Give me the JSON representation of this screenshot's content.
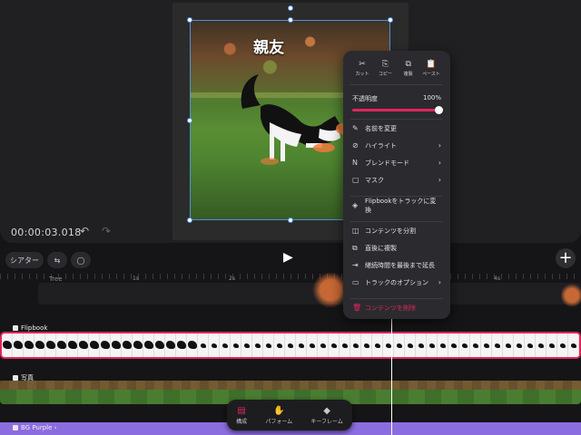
{
  "canvas": {
    "title_text": "親友",
    "timecode": "00:00:03.018"
  },
  "controls": {
    "theater_label": "シアター"
  },
  "timeline": {
    "ruler_labels": [
      "1s",
      "2s",
      "3s",
      "4s"
    ],
    "tree_track_label": "Tree",
    "flipbook_track_label": "Flipbook",
    "bg_track_label": "写真",
    "purple_track_label": "BG Purple",
    "frame_count": 53
  },
  "toolbar": {
    "items": [
      {
        "label": "構成",
        "icon": "compose-icon"
      },
      {
        "label": "パフォーム",
        "icon": "hand-icon"
      },
      {
        "label": "キーフレーム",
        "icon": "keyframe-icon"
      }
    ]
  },
  "menu": {
    "top_actions": [
      {
        "label": "カット",
        "icon": "scissors-icon",
        "glyph": "✂"
      },
      {
        "label": "コピー",
        "icon": "copy-icon",
        "glyph": "⎘"
      },
      {
        "label": "複製",
        "icon": "duplicate-icon",
        "glyph": "⧉"
      },
      {
        "label": "ペースト",
        "icon": "paste-icon",
        "glyph": "📋"
      }
    ],
    "opacity_label": "不透明度",
    "opacity_value": "100%",
    "opacity_fraction": 1.0,
    "items": [
      {
        "label": "名前を変更",
        "icon": "pencil-icon",
        "glyph": "✎",
        "chevron": false
      },
      {
        "label": "ハイライト",
        "icon": "highlight-icon",
        "glyph": "⊘",
        "chevron": true
      },
      {
        "label": "ブレンドモード",
        "icon": "blend-icon",
        "glyph": "N",
        "chevron": true
      },
      {
        "label": "マスク",
        "icon": "mask-icon",
        "glyph": "▢",
        "chevron": true
      }
    ],
    "items2": [
      {
        "label": "Flipbookをトラックに変換",
        "icon": "layers-icon",
        "glyph": "◈",
        "chevron": false
      }
    ],
    "items3": [
      {
        "label": "コンテンツを分割",
        "icon": "split-icon",
        "glyph": "◫",
        "chevron": false
      },
      {
        "label": "直後に複製",
        "icon": "duplicate-after-icon",
        "glyph": "⧉",
        "chevron": false
      },
      {
        "label": "継続時間を最後まで延長",
        "icon": "extend-icon",
        "glyph": "⇥",
        "chevron": false
      },
      {
        "label": "トラックのオプション",
        "icon": "track-options-icon",
        "glyph": "▭",
        "chevron": true
      }
    ],
    "delete_label": "コンテンツを削除"
  },
  "colors": {
    "accent": "#e0265b",
    "selection": "#4a90e2",
    "purple_track": "#8c6de0"
  }
}
